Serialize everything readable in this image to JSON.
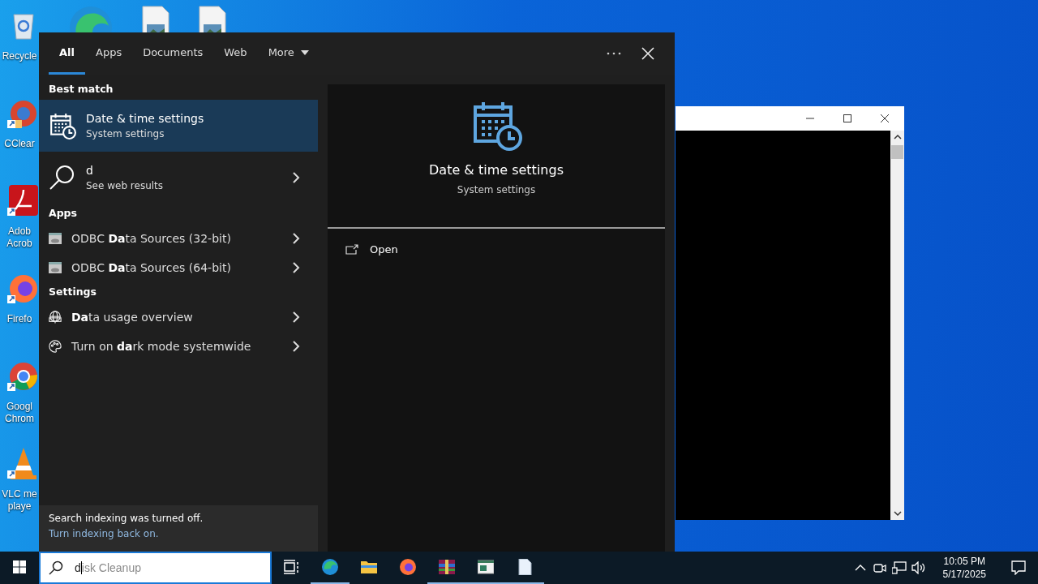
{
  "desktop": {
    "icons": [
      {
        "kind": "recycle",
        "label": [
          "Recycle"
        ]
      },
      {
        "kind": "ccleaner",
        "label": [
          "CClear"
        ]
      },
      {
        "kind": "acrobat",
        "label": [
          "Adob",
          "Acrob"
        ]
      },
      {
        "kind": "firefox",
        "label": [
          "Firefo"
        ]
      },
      {
        "kind": "chrome",
        "label": [
          "Googl",
          "Chrom"
        ]
      },
      {
        "kind": "vlc",
        "label": [
          "VLC me",
          "playe"
        ]
      }
    ],
    "top_icons": [
      {
        "kind": "edge"
      },
      {
        "kind": "image-file"
      },
      {
        "kind": "image-file"
      }
    ]
  },
  "search_panel": {
    "tabs": [
      {
        "label": "All",
        "selected": true
      },
      {
        "label": "Apps",
        "selected": false
      },
      {
        "label": "Documents",
        "selected": false
      },
      {
        "label": "Web",
        "selected": false
      }
    ],
    "more_menu": {
      "label": "More"
    },
    "sections": [
      {
        "heading": "Best match",
        "items": [
          {
            "kind": "match",
            "title": "Date & time settings",
            "subtitle": "System settings",
            "selected": true
          },
          {
            "kind": "web",
            "title": "d",
            "subtitle": "See web results",
            "selected": false
          }
        ]
      },
      {
        "heading": "Apps",
        "items": [
          {
            "kind": "app",
            "title": "ODBC **Da**ta Sources (32-bit)",
            "selected": false
          },
          {
            "kind": "app",
            "title": "ODBC **Da**ta Sources (64-bit)",
            "selected": false
          }
        ]
      },
      {
        "heading": "Settings",
        "items": [
          {
            "kind": "datausage",
            "title": "**Da**ta usage overview",
            "selected": false
          },
          {
            "kind": "personalize",
            "title": "Turn on **da**rk mode systemwide",
            "selected": false
          }
        ]
      }
    ],
    "preview": {
      "title": "Date & time settings",
      "subtitle": "System settings",
      "actions": [
        {
          "label": "Open"
        }
      ]
    },
    "notice": {
      "text": "Search indexing was turned off.",
      "link": "Turn indexing back on."
    }
  },
  "taskbar": {
    "search": {
      "typed": "d",
      "suggestion": "isk Cleanup"
    },
    "apps": [
      {
        "kind": "taskview",
        "running": false
      },
      {
        "kind": "edge",
        "running": true
      },
      {
        "kind": "folder",
        "running": false
      },
      {
        "kind": "firefox",
        "running": false
      },
      {
        "kind": "winrar",
        "running": true
      },
      {
        "kind": "window",
        "running": true
      },
      {
        "kind": "file",
        "running": true
      }
    ],
    "clock": {
      "time": "10:05 PM",
      "date": "5/17/2025"
    }
  }
}
